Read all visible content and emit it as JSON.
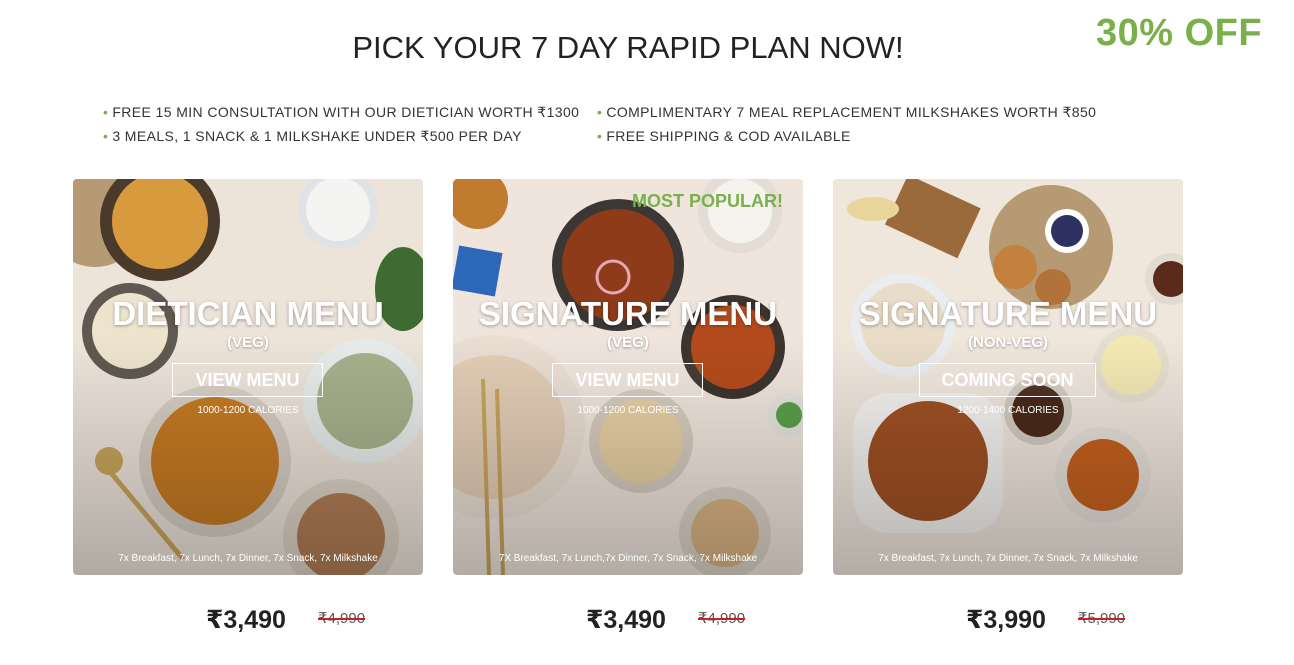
{
  "header": {
    "title": "PICK YOUR 7 DAY RAPID PLAN NOW!",
    "discount_badge": "30% OFF"
  },
  "benefits": {
    "left": [
      "FREE 15 MIN CONSULTATION WITH OUR DIETICIAN WORTH ₹1300",
      "3 MEALS, 1 SNACK & 1 MILKSHAKE UNDER ₹500 PER DAY"
    ],
    "right": [
      "COMPLIMENTARY 7 MEAL REPLACEMENT MILKSHAKES WORTH ₹850",
      "FREE SHIPPING & COD AVAILABLE"
    ]
  },
  "plans": [
    {
      "name": "DIETICIAN MENU",
      "type": "(VEG)",
      "button": "VIEW MENU",
      "calories": "1000-1200 CALORIES",
      "includes": "7x Breakfast, 7x Lunch, 7x Dinner, 7x Snack, 7x Milkshake",
      "price": "₹3,490",
      "mrp": "₹4,990"
    },
    {
      "name": "SIGNATURE MENU",
      "type": "(VEG)",
      "button": "VIEW MENU",
      "calories": "1000-1200 CALORIES",
      "includes": "7X Breakfast, 7x Lunch,7x Dinner, 7x Snack, 7x Milkshake",
      "badge": "MOST POPULAR!",
      "price": "₹3,490",
      "mrp": "₹4,990"
    },
    {
      "name": "SIGNATURE MENU",
      "type": "(NON-VEG)",
      "button": "COMING SOON",
      "calories": "1200-1400 CALORIES",
      "includes": "7x Breakfast, 7x Lunch, 7x Dinner, 7x Snack, 7x Milkshake",
      "price": "₹3,990",
      "mrp": "₹5,990"
    }
  ],
  "colors": {
    "accent": "#79b04c",
    "strike": "#c8202a"
  }
}
